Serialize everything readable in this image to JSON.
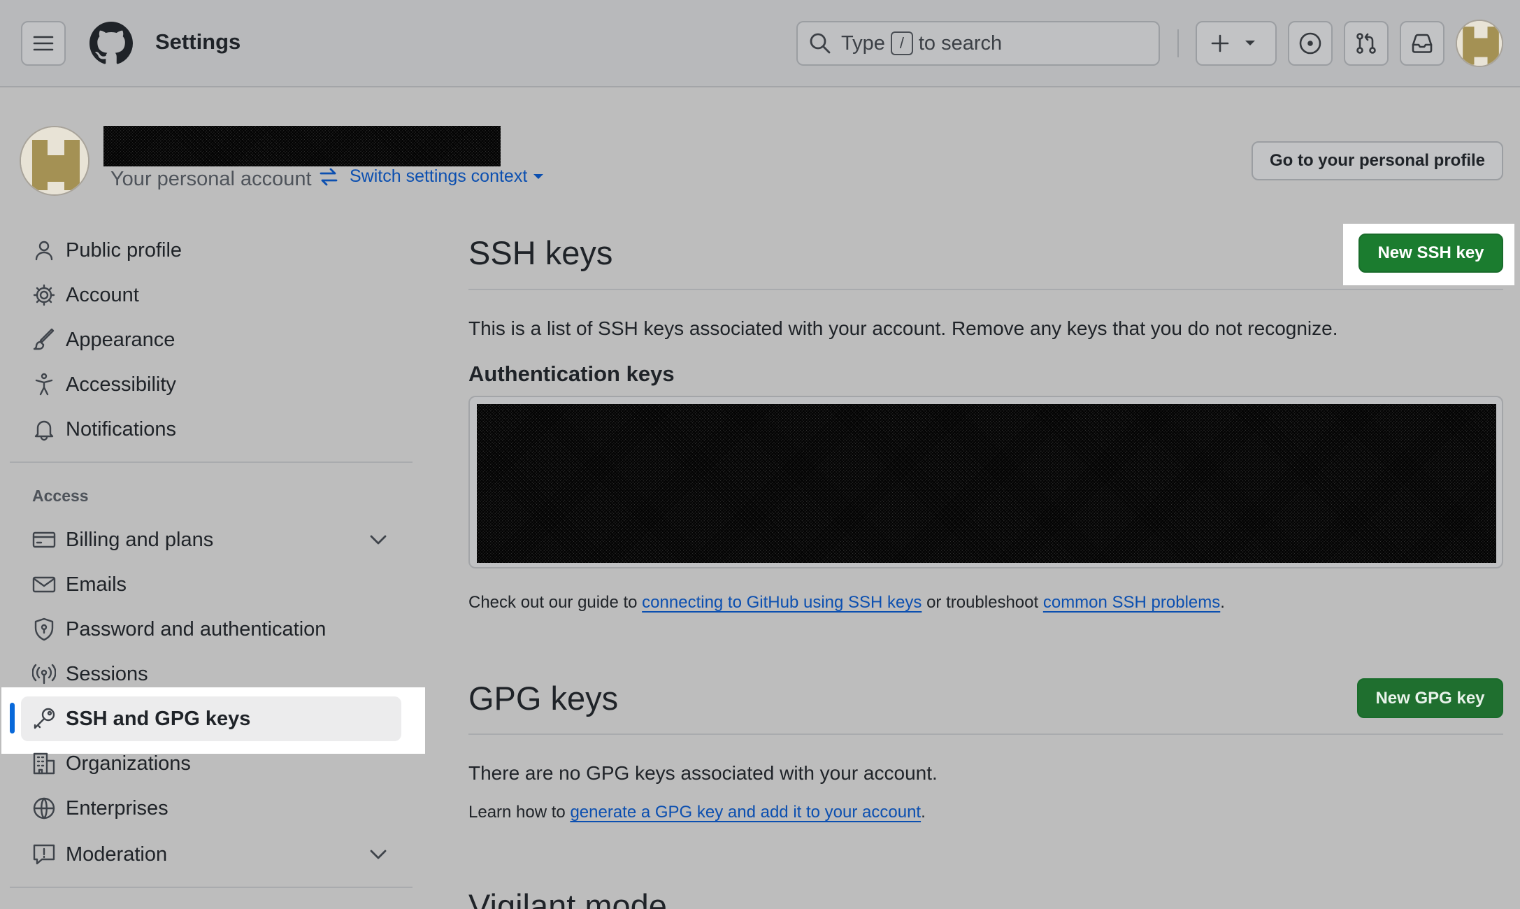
{
  "header": {
    "title": "Settings",
    "search_prefix": "Type",
    "search_key": "/",
    "search_suffix": "to search"
  },
  "account": {
    "personal_label": "Your personal account",
    "switch_context": "Switch settings context",
    "go_to_profile": "Go to your personal profile"
  },
  "sidebar": {
    "items_top": [
      {
        "label": "Public profile",
        "icon": "person-icon"
      },
      {
        "label": "Account",
        "icon": "gear-icon"
      },
      {
        "label": "Appearance",
        "icon": "paintbrush-icon"
      },
      {
        "label": "Accessibility",
        "icon": "accessibility-icon"
      },
      {
        "label": "Notifications",
        "icon": "bell-icon"
      }
    ],
    "access_heading": "Access",
    "items_access": [
      {
        "label": "Billing and plans",
        "icon": "credit-card-icon"
      },
      {
        "label": "Emails",
        "icon": "mail-icon"
      },
      {
        "label": "Password and authentication",
        "icon": "shield-icon"
      },
      {
        "label": "Sessions",
        "icon": "broadcast-icon"
      },
      {
        "label": "SSH and GPG keys",
        "icon": "key-icon",
        "active": true
      },
      {
        "label": "Organizations",
        "icon": "organization-icon"
      },
      {
        "label": "Enterprises",
        "icon": "globe-icon"
      },
      {
        "label": "Moderation",
        "icon": "report-icon"
      }
    ]
  },
  "ssh": {
    "title": "SSH keys",
    "new_button": "New SSH key",
    "description": "This is a list of SSH keys associated with your account. Remove any keys that you do not recognize.",
    "auth_heading": "Authentication keys",
    "guide_prefix": "Check out our guide to",
    "guide_link1": "connecting to GitHub using SSH keys",
    "guide_middle": "or troubleshoot",
    "guide_link2": "common SSH problems",
    "guide_suffix": "."
  },
  "gpg": {
    "title": "GPG keys",
    "new_button": "New GPG key",
    "empty": "There are no GPG keys associated with your account.",
    "learn_prefix": "Learn how to",
    "learn_link": "generate a GPG key and add it to your account",
    "learn_suffix": "."
  },
  "vigilant": {
    "title": "Vigilant mode"
  },
  "colors": {
    "primary_green": "#1b7c2f",
    "link_blue": "#0b4fb0",
    "active_indicator": "#0969da"
  }
}
